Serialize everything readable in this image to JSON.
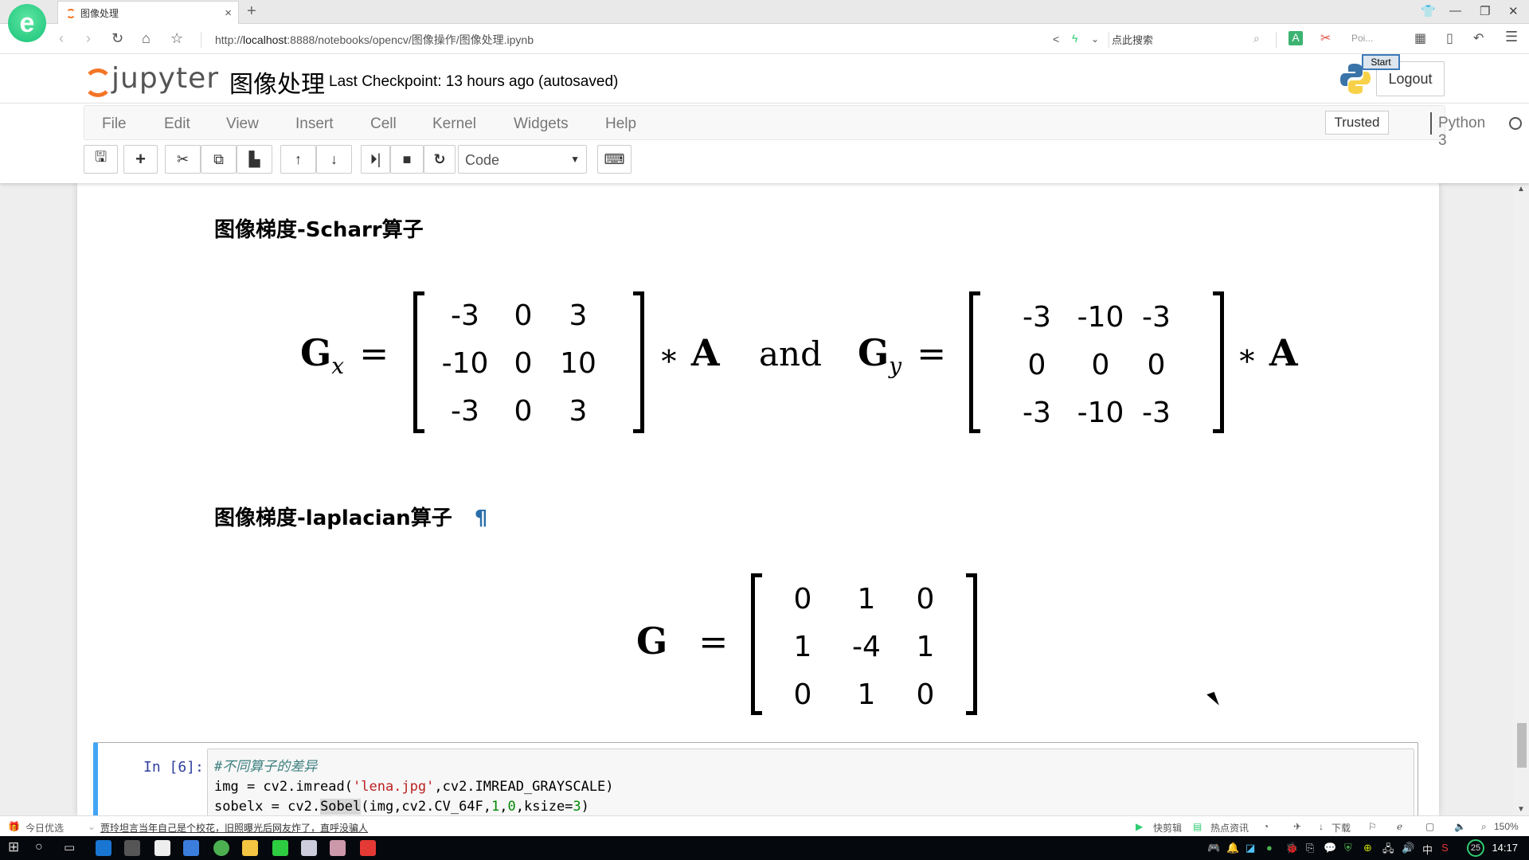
{
  "browser": {
    "tab_title": "图像处理",
    "url_prefix": "http://",
    "url_host": "localhost",
    "url_rest": ":8888/notebooks/opencv/图像操作/图像处理.ipynb",
    "search_placeholder": "点此搜索",
    "ext_label": "Poi...",
    "new_tab": "+",
    "tab_close": "×"
  },
  "jupyter": {
    "logo_text": "jupyter",
    "notebook_title": "图像处理",
    "checkpoint": "Last Checkpoint: 13 hours ago (autosaved)",
    "logout": "Logout",
    "tooltip": "Start",
    "trusted": "Trusted",
    "kernel": "Python 3"
  },
  "menu": [
    "File",
    "Edit",
    "View",
    "Insert",
    "Cell",
    "Kernel",
    "Widgets",
    "Help"
  ],
  "toolbar": {
    "cell_type": "Code",
    "buttons": [
      "save",
      "insert-below",
      "cut",
      "copy",
      "paste",
      "move-up",
      "move-down",
      "run",
      "interrupt",
      "restart",
      "command-palette"
    ]
  },
  "content": {
    "scharr_heading": "图像梯度-Scharr算子",
    "laplacian_heading": "图像梯度-laplacian算子",
    "anchor": "¶",
    "gx_symbol": "G",
    "gx_sub": "x",
    "gy_symbol": "G",
    "gy_sub": "y",
    "equals": "=",
    "times": "∗",
    "A": "A",
    "and": "and",
    "gx_matrix": [
      [
        "-3",
        "0",
        "3"
      ],
      [
        "-10",
        "0",
        "10"
      ],
      [
        "-3",
        "0",
        "3"
      ]
    ],
    "gy_matrix": [
      [
        "-3",
        "-10",
        "-3"
      ],
      [
        "0",
        "0",
        "0"
      ],
      [
        "-3",
        "-10",
        "-3"
      ]
    ],
    "g_symbol": "G",
    "g_matrix": [
      [
        "0",
        "1",
        "0"
      ],
      [
        "1",
        "-4",
        "1"
      ],
      [
        "0",
        "1",
        "0"
      ]
    ]
  },
  "code_cell": {
    "prompt": "In [6]:",
    "line1_comment": "#不同算子的差异",
    "line2_a": "img = cv2.imread(",
    "line2_str": "'lena.jpg'",
    "line2_b": ",cv2.IMREAD_GRAYSCALE)",
    "line3_a": "sobelx = cv2.",
    "line3_hl": "Sobel",
    "line3_b": "(img,cv2.CV_64F,",
    "line3_n1": "1",
    "line3_c": ",",
    "line3_n2": "0",
    "line3_d": ",ksize=",
    "line3_n3": "3",
    "line3_e": ")"
  },
  "statusbar": {
    "today": "今日优选",
    "news": "贾玲坦言当年自己是个校花，旧照曝光后网友炸了，直呼没骗人",
    "clip": "快剪辑",
    "hot": "热点资讯",
    "download": "下载",
    "zoom": "150%"
  },
  "taskbar": {
    "ime": "中",
    "badge": "25",
    "time": "14:17"
  }
}
